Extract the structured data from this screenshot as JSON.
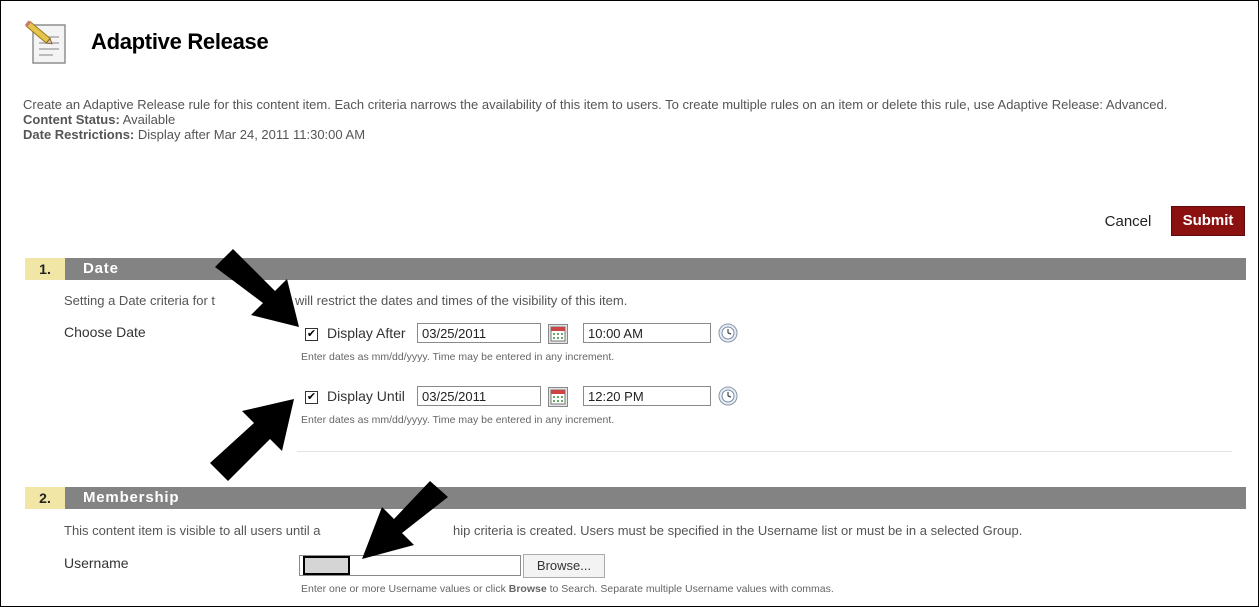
{
  "header": {
    "title": "Adaptive Release"
  },
  "intro": {
    "description": "Create an Adaptive Release rule for this content item. Each criteria narrows the availability of this item to users. To create multiple rules on an item or delete this rule, use Adaptive Release: Advanced.",
    "content_status_label": "Content Status:",
    "content_status_value": "Available",
    "date_restrictions_label": "Date Restrictions:",
    "date_restrictions_value": "Display after Mar 24, 2011 11:30:00 AM"
  },
  "actions": {
    "cancel": "Cancel",
    "submit": "Submit",
    "submit_color": "#8b1111"
  },
  "sections": [
    {
      "number": "1.",
      "title": "Date",
      "help_a": "Setting a Date criteria for t",
      "help_b": "will restrict the dates and times of the visibility of this item.",
      "field_label": "Choose Date",
      "display_after": {
        "checked": true,
        "check_glyph": "✔",
        "label": "Display After",
        "date": "03/25/2011",
        "time": "10:00 AM",
        "help": "Enter dates as mm/dd/yyyy. Time may be entered in any increment."
      },
      "display_until": {
        "checked": true,
        "check_glyph": "✔",
        "label": "Display Until",
        "date": "03/25/2011",
        "time": "12:20 PM",
        "help": "Enter dates as mm/dd/yyyy. Time may be entered in any increment."
      }
    },
    {
      "number": "2.",
      "title": "Membership",
      "help_a": "This content item is visible to all users until a",
      "help_b": "hip criteria is created. Users must be specified in the Username list or must be in a selected Group.",
      "field_label": "Username",
      "username_value": "",
      "browse": "Browse...",
      "help_prefix": "Enter one or more Username values or click ",
      "help_bold": "Browse",
      "help_suffix": " to Search. Separate multiple Username values with commas."
    }
  ],
  "icons": {
    "page": "page-edit-icon",
    "calendar": "calendar-icon",
    "clock": "clock-icon",
    "annotation": "black-arrow-icon"
  },
  "colors": {
    "section_bar": "#838383",
    "section_number_bg": "#f1e6a6"
  }
}
